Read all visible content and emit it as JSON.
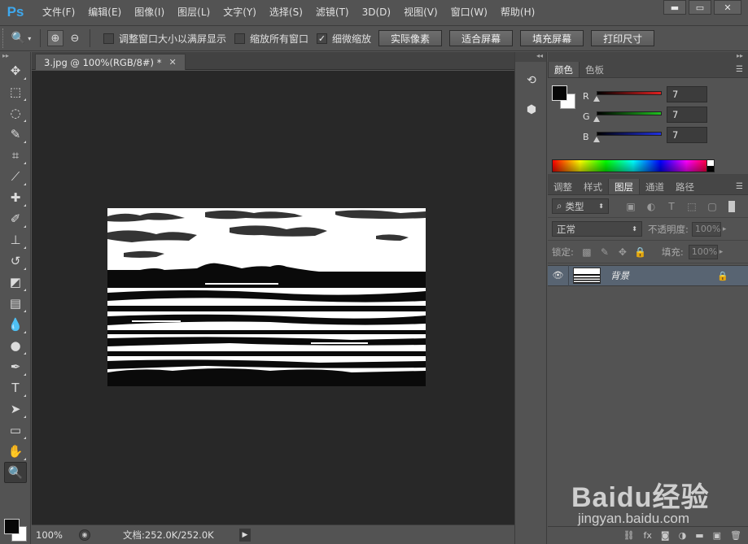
{
  "app": {
    "logo": "Ps"
  },
  "menu": [
    "文件(F)",
    "编辑(E)",
    "图像(I)",
    "图层(L)",
    "文字(Y)",
    "选择(S)",
    "滤镜(T)",
    "3D(D)",
    "视图(V)",
    "窗口(W)",
    "帮助(H)"
  ],
  "window_controls": {
    "minimize": "▬",
    "maximize": "▭",
    "close": "✕"
  },
  "options": {
    "tool_icon": "zoom-icon",
    "checks": [
      {
        "label": "调整窗口大小以满屏显示",
        "checked": false
      },
      {
        "label": "缩放所有窗口",
        "checked": false
      },
      {
        "label": "细微缩放",
        "checked": true
      }
    ],
    "buttons": [
      "实际像素",
      "适合屏幕",
      "填充屏幕",
      "打印尺寸"
    ]
  },
  "document": {
    "tab_title": "3.jpg @ 100%(RGB/8#) *",
    "zoom": "100%",
    "info": "文档:252.0K/252.0K"
  },
  "color_panel": {
    "tabs": [
      "颜色",
      "色板"
    ],
    "channels": [
      {
        "label": "R",
        "value": "7",
        "color": "#e02020"
      },
      {
        "label": "G",
        "value": "7",
        "color": "#20c020"
      },
      {
        "label": "B",
        "value": "7",
        "color": "#2030e0"
      }
    ]
  },
  "layers_panel": {
    "tabs": [
      "调整",
      "样式",
      "图层",
      "通道",
      "路径"
    ],
    "active_tab": "图层",
    "filter_kind": "类型",
    "blend_mode": "正常",
    "opacity_label": "不透明度:",
    "opacity_value": "100%",
    "lock_label": "锁定:",
    "fill_label": "填充:",
    "fill_value": "100%",
    "layers": [
      {
        "name": "背景",
        "visible": true,
        "locked": true
      }
    ],
    "footer_icons": [
      "link-icon",
      "fx-icon",
      "mask-icon",
      "adjustment-icon",
      "folder-icon",
      "new-layer-icon",
      "trash-icon"
    ]
  },
  "watermark": {
    "text": "Baidu经验",
    "sub": "jingyan.baidu.com"
  }
}
